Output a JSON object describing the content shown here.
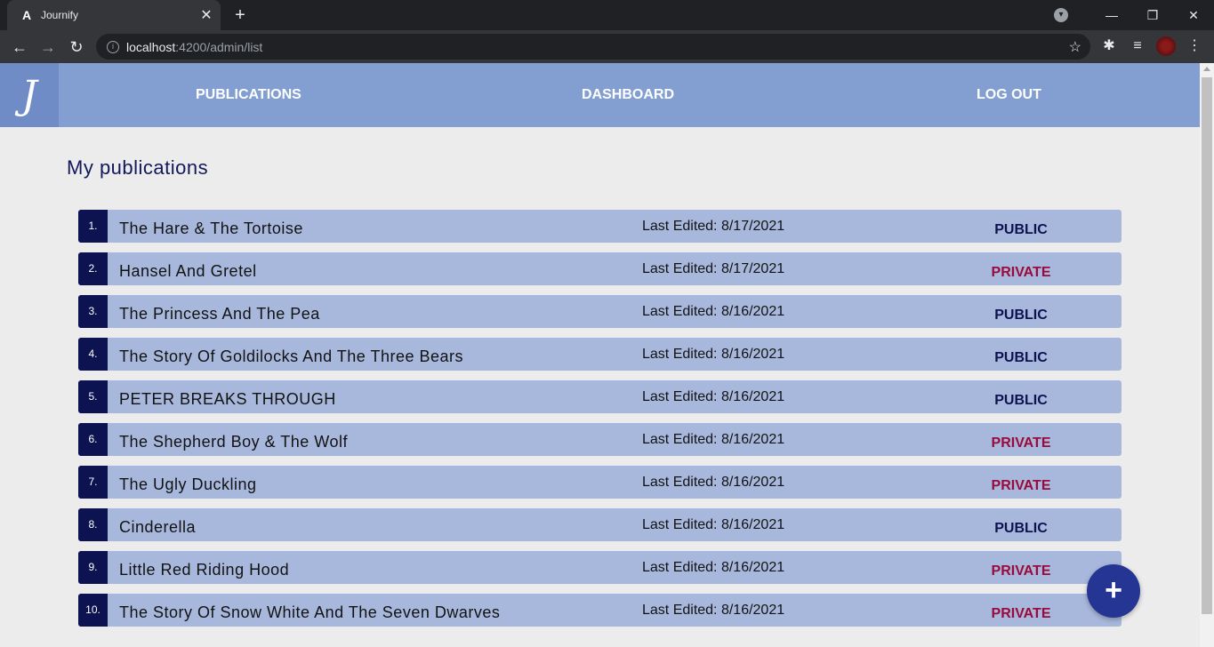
{
  "browser": {
    "tab_title": "Journify",
    "tab_favicon": "A",
    "tab_close": "✕",
    "new_tab": "+",
    "url_host": "localhost",
    "url_path": ":4200/admin/list",
    "icons": {
      "back": "back-arrow-icon",
      "forward": "forward-arrow-icon",
      "reload": "reload-icon",
      "info": "info-icon",
      "star": "star-icon",
      "extensions": "puzzle-icon",
      "media": "media-queue-icon",
      "menu": "kebab-menu-icon"
    }
  },
  "header": {
    "logo": "J",
    "nav": [
      {
        "label": "PUBLICATIONS"
      },
      {
        "label": "DASHBOARD"
      },
      {
        "label": "LOG OUT"
      }
    ]
  },
  "page": {
    "title": "My publications"
  },
  "publications": [
    {
      "num": "1.",
      "title": "The Hare & The Tortoise",
      "date": "Last Edited: 8/17/2021",
      "status": "PUBLIC"
    },
    {
      "num": "2.",
      "title": "Hansel And Gretel",
      "date": "Last Edited: 8/17/2021",
      "status": "PRIVATE"
    },
    {
      "num": "3.",
      "title": "The Princess And The Pea",
      "date": "Last Edited: 8/16/2021",
      "status": "PUBLIC"
    },
    {
      "num": "4.",
      "title": "The Story Of Goldilocks And The Three Bears",
      "date": "Last Edited: 8/16/2021",
      "status": "PUBLIC"
    },
    {
      "num": "5.",
      "title": "PETER BREAKS THROUGH",
      "date": "Last Edited: 8/16/2021",
      "status": "PUBLIC"
    },
    {
      "num": "6.",
      "title": "The Shepherd Boy & The Wolf",
      "date": "Last Edited: 8/16/2021",
      "status": "PRIVATE"
    },
    {
      "num": "7.",
      "title": "The Ugly Duckling",
      "date": "Last Edited: 8/16/2021",
      "status": "PRIVATE"
    },
    {
      "num": "8.",
      "title": "Cinderella",
      "date": "Last Edited: 8/16/2021",
      "status": "PUBLIC"
    },
    {
      "num": "9.",
      "title": "Little Red Riding Hood",
      "date": "Last Edited: 8/16/2021",
      "status": "PRIVATE"
    },
    {
      "num": "10.",
      "title": "The Story Of Snow White And The Seven Dwarves",
      "date": "Last Edited: 8/16/2021",
      "status": "PRIVATE"
    }
  ],
  "fab": {
    "label": "+",
    "icon": "plus-icon"
  },
  "colors": {
    "header_bg": "#839fd2",
    "row_bg": "#a8b8dc",
    "num_bg": "#0d1250",
    "public": "#0d1250",
    "private": "#9b0a3c",
    "fab_bg": "#253594"
  }
}
